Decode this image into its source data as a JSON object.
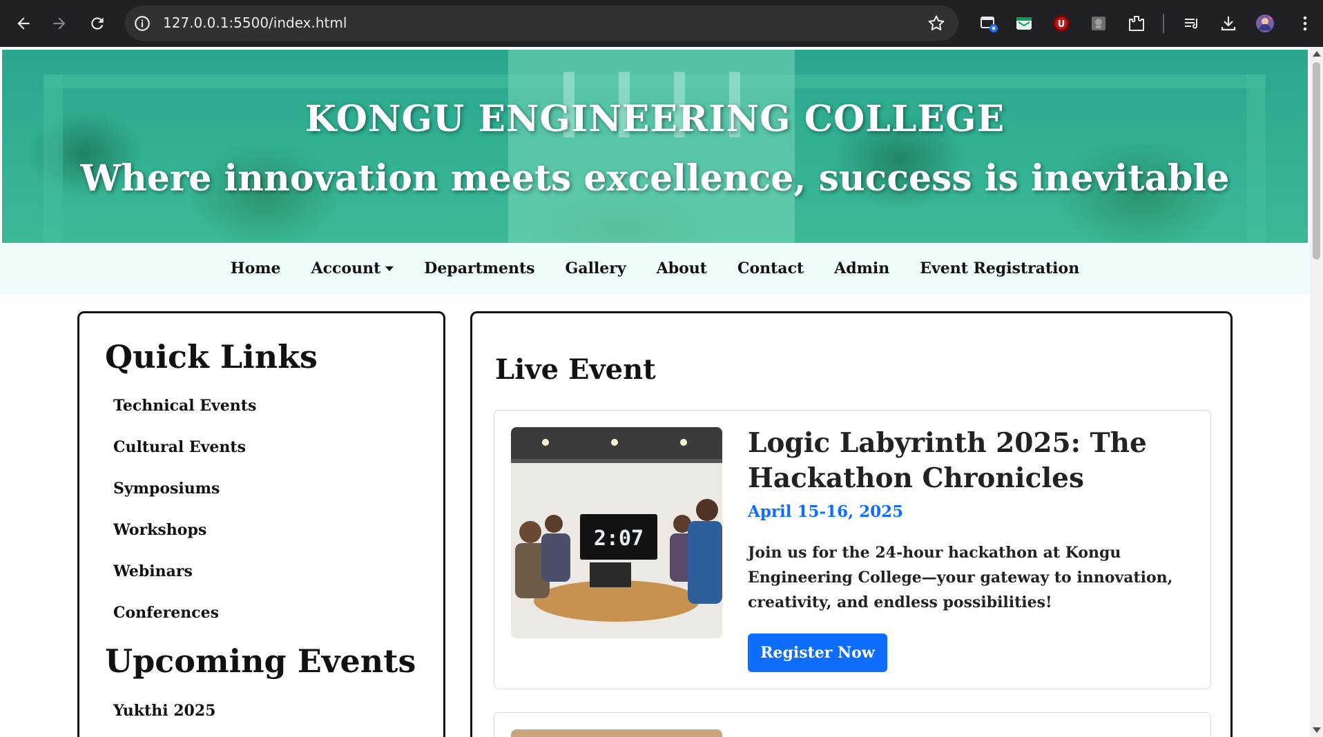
{
  "browser": {
    "url": "127.0.0.1:5500/index.html",
    "icons": [
      "back-icon",
      "forward-icon",
      "reload-icon",
      "site-info-icon",
      "bookmark-star-icon",
      "tab-search-icon",
      "mail-extension-icon",
      "ublock-extension-icon",
      "puzzle-extension-icon",
      "extensions-icon",
      "reading-list-icon",
      "download-icon",
      "profile-avatar",
      "menu-dots-icon"
    ]
  },
  "hero": {
    "title": "KONGU ENGINEERING COLLEGE",
    "tagline": "Where innovation meets excellence, success is inevitable"
  },
  "nav": {
    "items": [
      "Home",
      "Account",
      "Departments",
      "Gallery",
      "About",
      "Contact",
      "Admin",
      "Event Registration"
    ]
  },
  "sidebar": {
    "quick_links_title": "Quick Links",
    "quick_links": [
      "Technical Events",
      "Cultural Events",
      "Symposiums",
      "Workshops",
      "Webinars",
      "Conferences"
    ],
    "upcoming_title": "Upcoming Events",
    "upcoming": [
      "Yukthi 2025"
    ]
  },
  "main": {
    "section_title": "Live Event",
    "event": {
      "title": "Logic Labyrinth 2025: The Hackathon Chronicles",
      "date": "April 15-16, 2025",
      "description": "Join us for the 24-hour hackathon at Kongu Engineering College—your gateway to innovation, creativity, and endless possibilities!",
      "image_clock": "2:07",
      "button": "Register Now"
    }
  },
  "colors": {
    "accent": "#0d6efd",
    "hero": "#2fae92",
    "nav_bg": "#eefcfb"
  }
}
